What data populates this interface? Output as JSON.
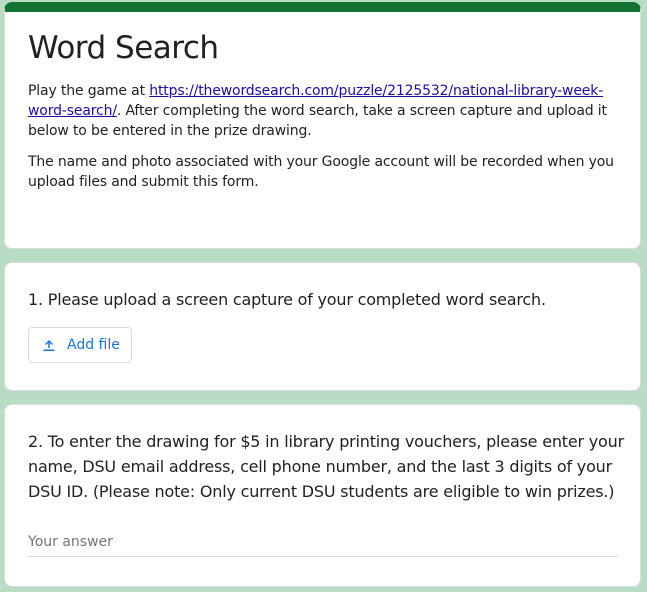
{
  "form": {
    "title": "Word Search",
    "description_1": {
      "prefix": "Play the game at ",
      "link": "https://thewordsearch.com/puzzle/2125532/national-library-week-word-search/",
      "suffix": ". After completing the word search, take a screen capture and upload it below to be entered in the prize drawing."
    },
    "description_2": "The name and photo associated with your Google account will be recorded when you upload files and submit this form."
  },
  "questions": [
    {
      "label": "1. Please upload a screen capture of your completed word search.",
      "button_label": "Add file",
      "button_icon": "upload-icon"
    },
    {
      "label": "2. To enter the drawing for $5 in library printing vouchers, please enter your name, DSU email address, cell phone number, and the last 3 digits of your DSU ID. (Please note: Only current DSU students are eligible to win prizes.)",
      "placeholder": "Your answer"
    }
  ],
  "colors": {
    "page_background": "#b8dcc4",
    "header_accent": "#137333",
    "link": "#1a0dab",
    "button_text": "#1a73e8"
  }
}
